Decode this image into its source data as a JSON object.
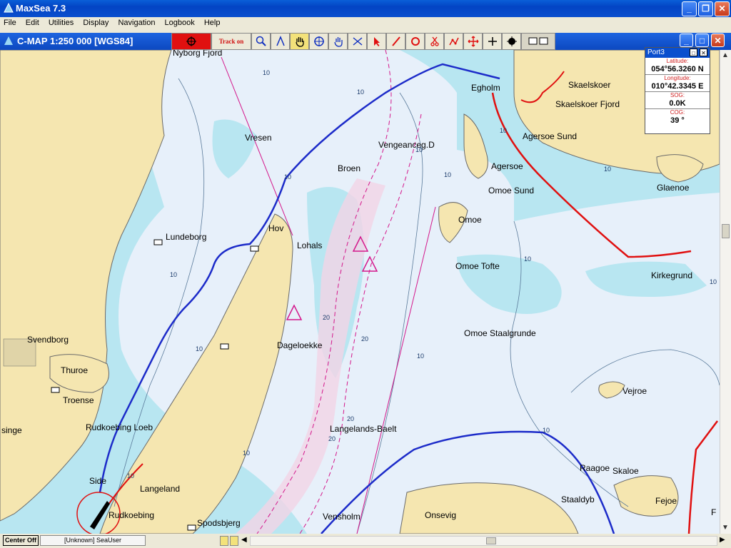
{
  "window": {
    "title": "MaxSea 7.3"
  },
  "menu": [
    "File",
    "Edit",
    "Utilities",
    "Display",
    "Navigation",
    "Logbook",
    "Help"
  ],
  "chart": {
    "title": "C-MAP  1:250 000 [WGS84]"
  },
  "toolbar": {
    "track_label": "Track on"
  },
  "port": {
    "title": "Port3",
    "latitude_label": "Latitude:",
    "latitude": "054°56.3260 N",
    "longitude_label": "Longitude:",
    "longitude": "010°42.3345 E",
    "sog_label": "SOG:",
    "sog": "0.0K",
    "cog_label": "COG:",
    "cog": "39 °"
  },
  "status": {
    "center_label": "Center Off",
    "user": "[Unknown] SeaUser"
  },
  "places": [
    "Nyborg Fjord",
    "Egholm",
    "Skaelskoer",
    "Skaelskoer Fjord",
    "Agersoe Sund",
    "Vresen",
    "Vengeanceg.D",
    "Broen",
    "Agersoe",
    "Omoe Sund",
    "Glaenoe",
    "Hov",
    "Lohals",
    "Omoe",
    "Lundeborg",
    "Omoe Tofte",
    "Kirkegrund",
    "Dageloekke",
    "Omoe Staalgrunde",
    "Svendborg",
    "Thuroe",
    "Troense",
    "Vejroe",
    "Rudkoebing Loeb",
    "singe",
    "Langelands-Baelt",
    "Side",
    "Langeland",
    "Raagoe",
    "Skaloe",
    "Staaldyb",
    "Fejoe",
    "Rudkoebing",
    "Vensholm",
    "Onsevig",
    "Spodsbjerg",
    "F"
  ],
  "depths": [
    "10",
    "10",
    "10",
    "10",
    "10",
    "10",
    "10",
    "10",
    "20",
    "20",
    "20",
    "20",
    "10",
    "10",
    "10",
    "10",
    "10",
    "10",
    "10"
  ],
  "colors": {
    "land": "#F5E6B0",
    "shallow": "#B8E6F1",
    "deep": "#E7F0FA",
    "track": "#1C2BC9",
    "route": "#E01010",
    "channel": "#D4178B"
  }
}
